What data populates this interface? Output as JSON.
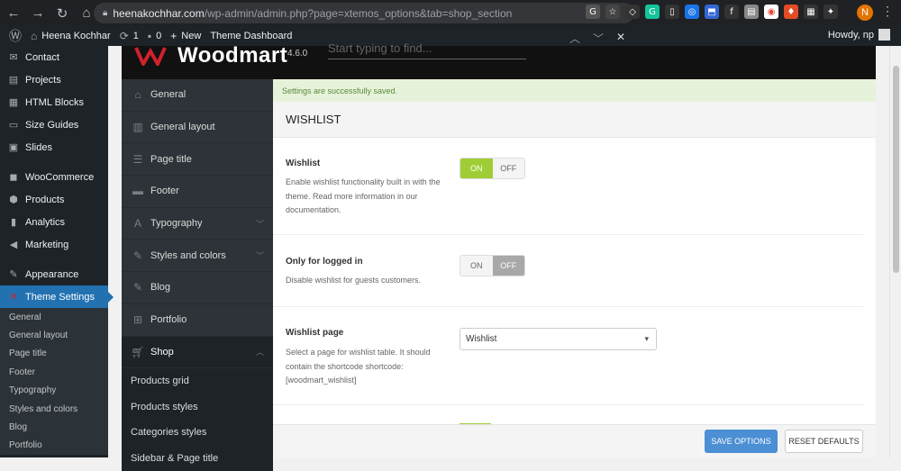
{
  "browser": {
    "url_host": "heenakochhar.com",
    "url_path": "/wp-admin/admin.php?page=xtemos_options&tab=shop_section",
    "profile_initial": "N"
  },
  "adminbar": {
    "site_name": "Heena Kochhar",
    "updates_count": "1",
    "comments_count": "0",
    "new_label": "New",
    "theme_dashboard": "Theme Dashboard",
    "howdy": "Howdy, np"
  },
  "wp_menu": {
    "items": [
      {
        "label": "Contact",
        "icon": "mail-icon"
      },
      {
        "label": "Projects",
        "icon": "folder-icon"
      },
      {
        "label": "HTML Blocks",
        "icon": "blocks-icon"
      },
      {
        "label": "Size Guides",
        "icon": "ruler-icon"
      },
      {
        "label": "Slides",
        "icon": "slides-icon"
      },
      {
        "label": "WooCommerce",
        "icon": "woo-icon"
      },
      {
        "label": "Products",
        "icon": "box-icon"
      },
      {
        "label": "Analytics",
        "icon": "chart-icon"
      },
      {
        "label": "Marketing",
        "icon": "megaphone-icon"
      },
      {
        "label": "Appearance",
        "icon": "brush-icon"
      },
      {
        "label": "Theme Settings",
        "icon": "theme-icon"
      }
    ],
    "sub_items": [
      "General",
      "General layout",
      "Page title",
      "Footer",
      "Typography",
      "Styles and colors",
      "Blog",
      "Portfolio"
    ]
  },
  "theme": {
    "name": "Woodmart",
    "version": "4.6.0",
    "search_placeholder": "Start typing to find..."
  },
  "options_menu": {
    "items": [
      {
        "label": "General",
        "icon": "home-icon"
      },
      {
        "label": "General layout",
        "icon": "layout-icon"
      },
      {
        "label": "Page title",
        "icon": "title-icon"
      },
      {
        "label": "Footer",
        "icon": "footer-icon"
      },
      {
        "label": "Typography",
        "icon": "font-icon"
      },
      {
        "label": "Styles and colors",
        "icon": "brush-icon"
      },
      {
        "label": "Blog",
        "icon": "blog-icon"
      },
      {
        "label": "Portfolio",
        "icon": "grid-icon"
      },
      {
        "label": "Shop",
        "icon": "cart-icon"
      }
    ],
    "shop_sub": [
      "Products grid",
      "Products styles",
      "Categories styles",
      "Sidebar & Page title"
    ]
  },
  "main": {
    "notice": "Settings are successfully saved.",
    "section_title": "WISHLIST",
    "fields": {
      "wishlist": {
        "title": "Wishlist",
        "desc": "Enable wishlist functionality built in with the theme. Read more information in our documentation.",
        "on": "ON",
        "off": "OFF",
        "value": "on"
      },
      "logged_in": {
        "title": "Only for logged in",
        "desc": "Disable wishlist for guests customers.",
        "on": "ON",
        "off": "OFF",
        "value": "off"
      },
      "page": {
        "title": "Wishlist page",
        "desc": "Select a page for wishlist table. It should contain the shortcode shortcode: [woodmart_wishlist]",
        "selected": "Wishlist"
      }
    }
  },
  "footer": {
    "save": "SAVE OPTIONS",
    "reset": "RESET DEFAULTS"
  },
  "colors": {
    "toggle_on": "#a0cd35",
    "save_button": "#4c8fd4",
    "wp_active": "#2271b1"
  }
}
